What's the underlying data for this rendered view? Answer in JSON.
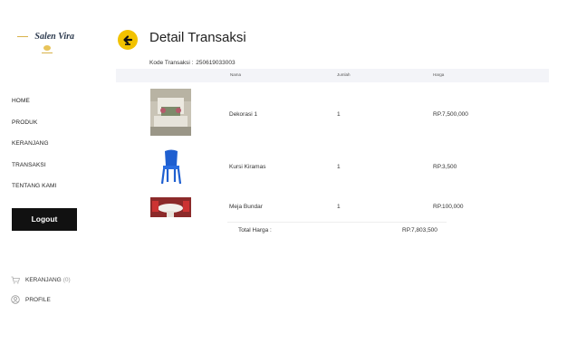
{
  "brand": {
    "logo_text": "Salen Vira"
  },
  "nav": {
    "items": [
      "HOME",
      "PRODUK",
      "KERANJANG",
      "TRANSAKSI",
      "TENTANG KAMI"
    ]
  },
  "logout_label": "Logout",
  "footer": {
    "cart_label": "KERANJANG",
    "cart_count": "(0)",
    "profile_label": "PROFILE"
  },
  "page": {
    "title": "Detail Transaksi",
    "kode_label": "Kode Transaksi :",
    "kode_value": "250619033003"
  },
  "table": {
    "headers": [
      "Nama",
      "Jumlah",
      "Harga"
    ],
    "rows": [
      {
        "nama": "Dekorasi 1",
        "jumlah": "1",
        "harga": "RP.7,500,000",
        "image": "decoration-photo"
      },
      {
        "nama": "Kursi Kiramas",
        "jumlah": "1",
        "harga": "RP.3,500",
        "image": "blue-chair-photo"
      },
      {
        "nama": "Meja Bundar",
        "jumlah": "1",
        "harga": "RP.100,000",
        "image": "round-table-photo"
      }
    ],
    "total_label": "Total Harga :",
    "total_value": "RP.7,803,500"
  },
  "colors": {
    "accent": "#f2c200",
    "button_dark": "#111111",
    "header_bg": "#f3f4f8"
  }
}
